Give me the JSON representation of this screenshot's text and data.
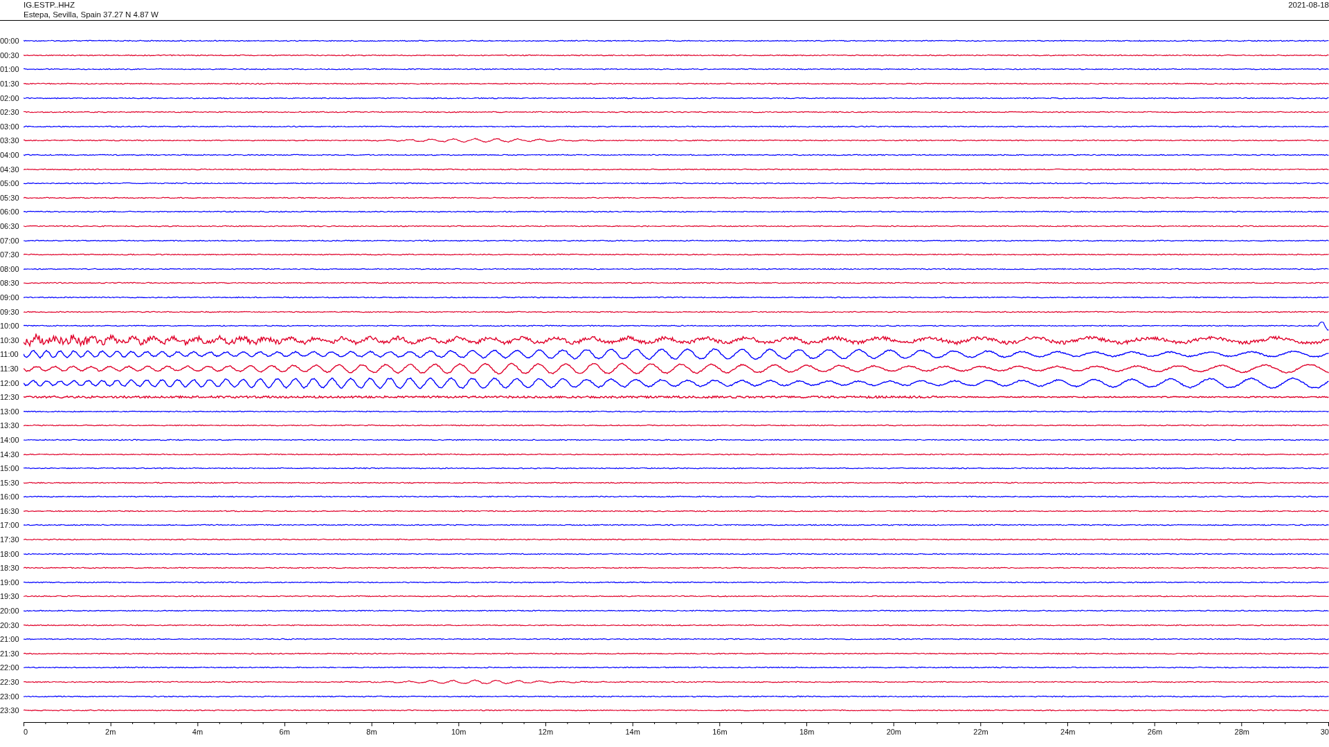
{
  "header": {
    "station": "IG.ESTP..HHZ",
    "location": "Estepa, Sevilla, Spain  37.27 N 4.87 W",
    "date": "2021-08-18"
  },
  "rows": [
    {
      "label": "00:00",
      "color": "#0000ff",
      "kind": "quiet"
    },
    {
      "label": "00:30",
      "color": "#e0002a",
      "kind": "quiet"
    },
    {
      "label": "01:00",
      "color": "#0000ff",
      "kind": "quiet"
    },
    {
      "label": "01:30",
      "color": "#e0002a",
      "kind": "quiet"
    },
    {
      "label": "02:00",
      "color": "#0000ff",
      "kind": "quiet"
    },
    {
      "label": "02:30",
      "color": "#e0002a",
      "kind": "quiet"
    },
    {
      "label": "03:00",
      "color": "#0000ff",
      "kind": "quiet"
    },
    {
      "label": "03:30",
      "color": "#e0002a",
      "kind": "burst"
    },
    {
      "label": "04:00",
      "color": "#0000ff",
      "kind": "quiet"
    },
    {
      "label": "04:30",
      "color": "#e0002a",
      "kind": "quiet"
    },
    {
      "label": "05:00",
      "color": "#0000ff",
      "kind": "quiet"
    },
    {
      "label": "05:30",
      "color": "#e0002a",
      "kind": "quiet"
    },
    {
      "label": "06:00",
      "color": "#0000ff",
      "kind": "quiet"
    },
    {
      "label": "06:30",
      "color": "#e0002a",
      "kind": "quiet"
    },
    {
      "label": "07:00",
      "color": "#0000ff",
      "kind": "quiet"
    },
    {
      "label": "07:30",
      "color": "#e0002a",
      "kind": "quiet"
    },
    {
      "label": "08:00",
      "color": "#0000ff",
      "kind": "quiet"
    },
    {
      "label": "08:30",
      "color": "#e0002a",
      "kind": "quiet"
    },
    {
      "label": "09:00",
      "color": "#0000ff",
      "kind": "quiet"
    },
    {
      "label": "09:30",
      "color": "#e0002a",
      "kind": "quiet"
    },
    {
      "label": "10:00",
      "color": "#0000ff",
      "kind": "onset"
    },
    {
      "label": "10:30",
      "color": "#e0002a",
      "kind": "event"
    },
    {
      "label": "11:00",
      "color": "#0000ff",
      "kind": "surface"
    },
    {
      "label": "11:30",
      "color": "#e0002a",
      "kind": "surface"
    },
    {
      "label": "12:00",
      "color": "#0000ff",
      "kind": "surface"
    },
    {
      "label": "12:30",
      "color": "#e0002a",
      "kind": "coda"
    },
    {
      "label": "13:00",
      "color": "#0000ff",
      "kind": "quiet"
    },
    {
      "label": "13:30",
      "color": "#e0002a",
      "kind": "quiet"
    },
    {
      "label": "14:00",
      "color": "#0000ff",
      "kind": "quiet"
    },
    {
      "label": "14:30",
      "color": "#e0002a",
      "kind": "quiet"
    },
    {
      "label": "15:00",
      "color": "#0000ff",
      "kind": "quiet"
    },
    {
      "label": "15:30",
      "color": "#e0002a",
      "kind": "quiet"
    },
    {
      "label": "16:00",
      "color": "#0000ff",
      "kind": "quiet"
    },
    {
      "label": "16:30",
      "color": "#e0002a",
      "kind": "quiet"
    },
    {
      "label": "17:00",
      "color": "#0000ff",
      "kind": "quiet"
    },
    {
      "label": "17:30",
      "color": "#e0002a",
      "kind": "quiet"
    },
    {
      "label": "18:00",
      "color": "#0000ff",
      "kind": "quiet"
    },
    {
      "label": "18:30",
      "color": "#e0002a",
      "kind": "quiet"
    },
    {
      "label": "19:00",
      "color": "#0000ff",
      "kind": "quiet"
    },
    {
      "label": "19:30",
      "color": "#e0002a",
      "kind": "quiet"
    },
    {
      "label": "20:00",
      "color": "#0000ff",
      "kind": "quiet"
    },
    {
      "label": "20:30",
      "color": "#e0002a",
      "kind": "quiet"
    },
    {
      "label": "21:00",
      "color": "#0000ff",
      "kind": "quiet"
    },
    {
      "label": "21:30",
      "color": "#e0002a",
      "kind": "quiet"
    },
    {
      "label": "22:00",
      "color": "#0000ff",
      "kind": "quiet"
    },
    {
      "label": "22:30",
      "color": "#e0002a",
      "kind": "burst"
    },
    {
      "label": "23:00",
      "color": "#0000ff",
      "kind": "quiet"
    },
    {
      "label": "23:30",
      "color": "#e0002a",
      "kind": "quiet"
    }
  ],
  "x_axis": {
    "ticks": [
      "0",
      "2m",
      "4m",
      "6m",
      "8m",
      "10m",
      "12m",
      "14m",
      "16m",
      "18m",
      "20m",
      "22m",
      "24m",
      "26m",
      "28m",
      "30"
    ]
  }
}
